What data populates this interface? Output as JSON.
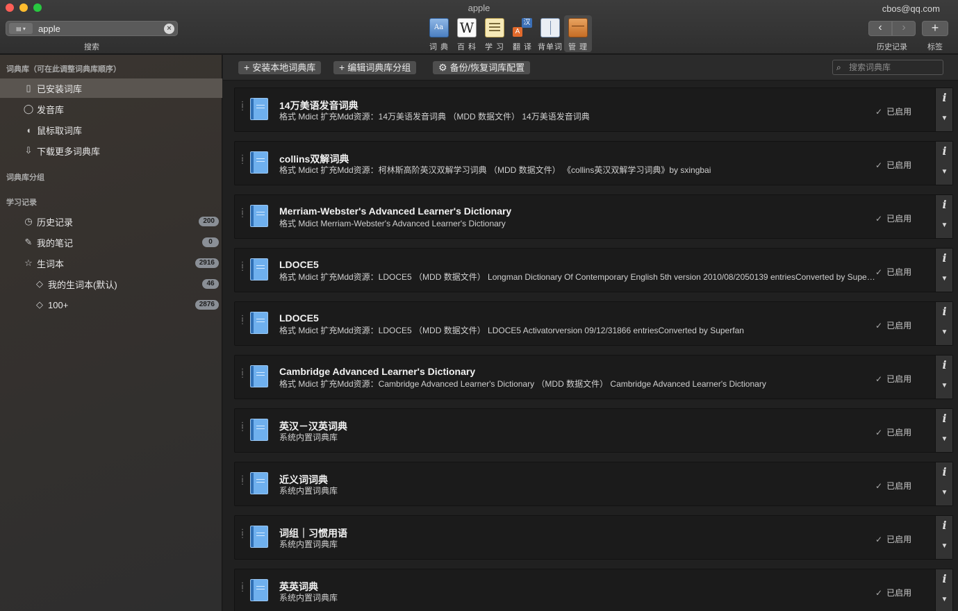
{
  "window": {
    "title": "apple",
    "user_email": "cbos@qq.com"
  },
  "search": {
    "mode_icon": "dictionary-mode-icon",
    "value": "apple",
    "caption": "搜索"
  },
  "toolbar": {
    "tools": [
      {
        "label": "词 典",
        "icon": "dictionary-icon"
      },
      {
        "label": "百 科",
        "icon": "wikipedia-icon"
      },
      {
        "label": "学 习",
        "icon": "study-icon"
      },
      {
        "label": "翻 译",
        "icon": "translate-icon"
      },
      {
        "label": "背单词",
        "icon": "vocabulary-icon"
      },
      {
        "label": "管 理",
        "icon": "manage-icon",
        "active": true
      }
    ],
    "history_caption": "历史记录",
    "tags_caption": "标签",
    "back_glyph": "‹",
    "forward_glyph": "›",
    "add_glyph": "+"
  },
  "sidebar": {
    "section_dict": "词典库（可在此调整词典库顺序）",
    "dict_items": [
      {
        "label": "已安装词库",
        "selected": true
      },
      {
        "label": "发音库"
      },
      {
        "label": "鼠标取词库"
      },
      {
        "label": "下载更多词典库"
      }
    ],
    "section_groups": "词典库分组",
    "section_study": "学习记录",
    "study_items": [
      {
        "label": "历史记录",
        "badge": "200"
      },
      {
        "label": "我的笔记",
        "badge": "0"
      },
      {
        "label": "生词本",
        "badge": "2916"
      },
      {
        "label": "我的生词本(默认)",
        "badge": "46"
      },
      {
        "label": "100+",
        "badge": "2876"
      }
    ]
  },
  "actions": {
    "install_local": "安装本地词典库",
    "edit_groups": "编辑词典库分组",
    "backup_restore": "备份/恢复词库配置",
    "search_placeholder": "搜索词典库"
  },
  "status_enabled": "已启用",
  "dictionaries": [
    {
      "title": "14万美语发音词典",
      "desc": "格式 Mdict  扩充Mdd资源：14万美语发音词典 （MDD 数据文件）  14万美语发音词典"
    },
    {
      "title": "collins双解词典",
      "desc": "格式 Mdict  扩充Mdd资源：柯林斯高阶英汉双解学习词典 （MDD 数据文件）  《collins英汉双解学习词典》by sxingbai"
    },
    {
      "title": "Merriam-Webster's Advanced Learner's Dictionary",
      "desc": "格式 Mdict  Merriam-Webster's Advanced Learner's Dictionary"
    },
    {
      "title": "LDOCE5",
      "desc": "格式 Mdict  扩充Mdd资源：LDOCE5 （MDD 数据文件）  Longman Dictionary Of Contemporary English 5th version 2010/08/2050139 entriesConverted by Superfan"
    },
    {
      "title": "LDOCE5",
      "desc": "格式 Mdict  扩充Mdd资源：LDOCE5 （MDD 数据文件）  LDOCE5 Activatorversion 09/12/31866 entriesConverted by Superfan"
    },
    {
      "title": "Cambridge Advanced Learner's Dictionary",
      "desc": "格式 Mdict  扩充Mdd资源：Cambridge Advanced Learner's Dictionary （MDD 数据文件）  Cambridge Advanced Learner's Dictionary"
    },
    {
      "title": "英汉－汉英词典",
      "desc": "系统内置词典库"
    },
    {
      "title": "近义词词典",
      "desc": "系统内置词典库"
    },
    {
      "title": "词组｜习惯用语",
      "desc": "系统内置词典库"
    },
    {
      "title": "英英词典",
      "desc": "系统内置词典库"
    }
  ]
}
